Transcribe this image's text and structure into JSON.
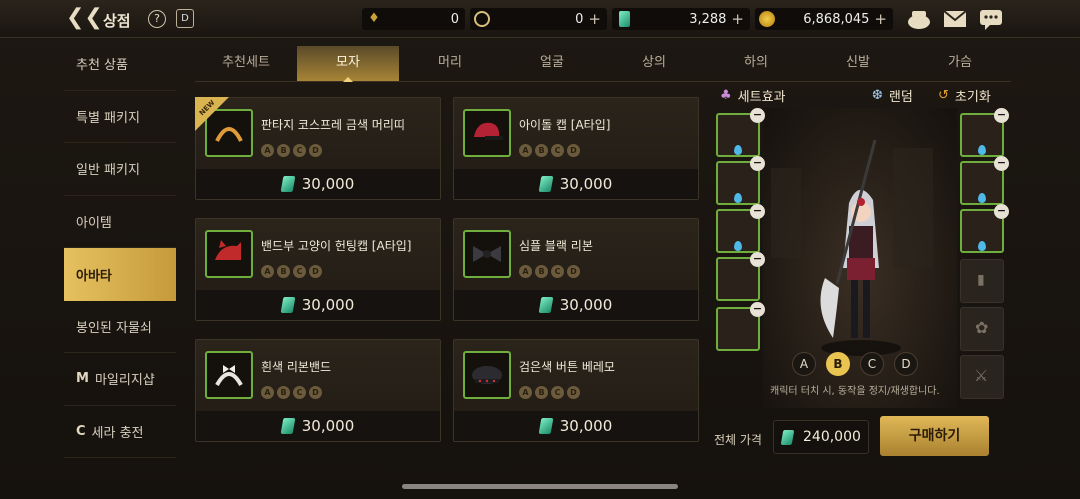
{
  "header": {
    "title": "상점",
    "back_icon": "back-arrow-icon",
    "help_label": "?",
    "dice_label": "D"
  },
  "currencies": [
    {
      "name": "gold-leaf",
      "value": "0",
      "color": "#c9a23c"
    },
    {
      "name": "cera-coin",
      "value": "0",
      "color": "#d8c07a"
    },
    {
      "name": "gem",
      "value": "3,288",
      "color": "#5fe0b0"
    },
    {
      "name": "gold",
      "value": "6,868,045",
      "color": "#e0a820"
    }
  ],
  "top_icons": [
    "treasure-pot-icon",
    "mail-icon",
    "chat-icon"
  ],
  "left_menu": [
    {
      "label": "추천 상품"
    },
    {
      "label": "특별 패키지"
    },
    {
      "label": "일반 패키지"
    },
    {
      "label": "아이템"
    },
    {
      "label": "아바타",
      "active": true
    },
    {
      "label": "봉인된 자물쇠"
    },
    {
      "label": "마일리지샵",
      "icon": "M"
    },
    {
      "label": "세라 충전",
      "icon": "C"
    }
  ],
  "tabs": [
    {
      "label": "추천세트"
    },
    {
      "label": "모자",
      "active": true
    },
    {
      "label": "머리"
    },
    {
      "label": "얼굴"
    },
    {
      "label": "상의"
    },
    {
      "label": "하의"
    },
    {
      "label": "신발"
    },
    {
      "label": "가슴"
    }
  ],
  "products": [
    {
      "name": "판타지 코스프레 금색 머리띠",
      "price": "30,000",
      "options": [
        "A",
        "B",
        "C",
        "D"
      ],
      "is_new": true,
      "new_label": "NEW",
      "icon": "headband-icon"
    },
    {
      "name": "아이돌 캡 [A타입]",
      "price": "30,000",
      "options": [
        "A",
        "B",
        "C",
        "D"
      ],
      "icon": "cap-icon"
    },
    {
      "name": "밴드부 고양이 헌팅캡 [A타입]",
      "price": "30,000",
      "options": [
        "A",
        "B",
        "C",
        "D"
      ],
      "icon": "cat-cap-icon"
    },
    {
      "name": "심플 블랙 리본",
      "price": "30,000",
      "options": [
        "A",
        "B",
        "C",
        "D"
      ],
      "icon": "ribbon-icon"
    },
    {
      "name": "흰색 리본밴드",
      "price": "30,000",
      "options": [
        "A",
        "B",
        "C",
        "D"
      ],
      "icon": "ribbon-band-icon"
    },
    {
      "name": "검은색 버튼 베레모",
      "price": "30,000",
      "options": [
        "A",
        "B",
        "C",
        "D"
      ],
      "icon": "beret-icon"
    }
  ],
  "right_panel": {
    "set_effect": "세트효과",
    "random": "랜덤",
    "reset": "초기화",
    "variants": [
      "A",
      "B",
      "C",
      "D"
    ],
    "active_variant": "B",
    "note": "캐릭터 터치 시, 동작을 정지/재생합니다.",
    "total_label": "전체 가격",
    "total_value": "240,000",
    "buy_label": "구매하기"
  }
}
